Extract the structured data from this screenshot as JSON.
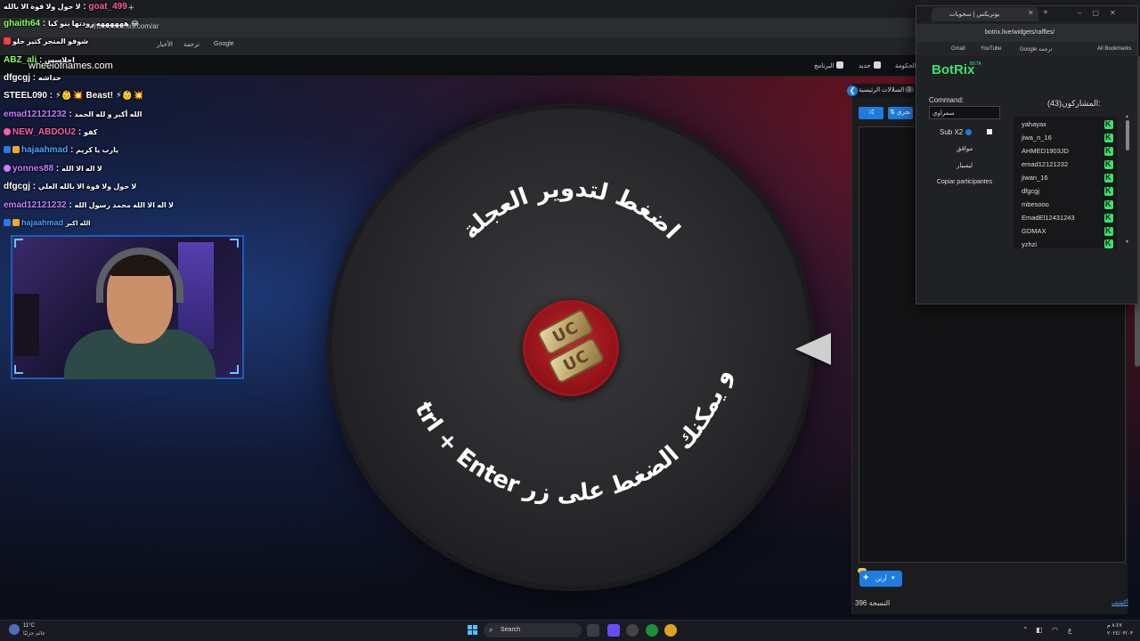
{
  "browser": {
    "new_tab": "+",
    "address_url": "wheelofnames.com/ar",
    "bookmarks": [
      "الأخبار",
      "ترجمة",
      "Google"
    ]
  },
  "site": {
    "logo": "wheelofnames.com",
    "nav": [
      "الحكومة",
      "جديد",
      "البرنامج"
    ]
  },
  "chat": [
    {
      "user": "goat_499",
      "msg": "لا حول ولا قوة الا بالله",
      "color": "#ff5fa0",
      "dir": "rtl-msg-first"
    },
    {
      "user": "ghaith64",
      "msg": "ههههههه زودتها بنو كيا 😂",
      "color": "#8cff5f"
    },
    {
      "user": "",
      "msg": "شوفو المتجر كثير حلو",
      "color": "#ff3b3b"
    },
    {
      "user": "ABZ_ali",
      "msg": "احلاسس",
      "color": "#8cff5f"
    },
    {
      "user": "dfgcgj",
      "msg": "حداشه",
      "color": "#ffffff"
    },
    {
      "user": "STEEL090",
      "msg": "⚡👶💥 Beast! ⚡👶💥",
      "color": "#ffffff"
    },
    {
      "user": "emad12121232",
      "msg": "الله أكبر و لله الحمد",
      "color": "#c77dff"
    },
    {
      "user": "NEW_ABDOU2",
      "msg": "كفو",
      "color": "#ff5fa0"
    },
    {
      "user": "hajaahmad",
      "msg": "يارب يا كريم",
      "color": "#4aa3ff"
    },
    {
      "user": "yonnes88",
      "msg": "لا اله الا الله",
      "color": "#c77dff"
    },
    {
      "user": "dfgcgj",
      "msg": "لا حول ولا قوة الا بالله العلي",
      "color": "#ffffff"
    },
    {
      "user": "emad12121232",
      "msg": "لا اله الا الله محمد رسول الله",
      "color": "#c77dff"
    },
    {
      "user": "hajaahmad",
      "msg": "الله اكبر",
      "color": "#4aa3ff"
    }
  ],
  "wheel": {
    "text_top": "اضغط لتدوير العجلة",
    "text_bottom_1": "أو يمكنك الضغط على زر",
    "text_bottom_2": "Ctrl + Enter",
    "center_label": "UC"
  },
  "entries": {
    "tabs": [
      "السلالات الرئيسية",
      "1"
    ],
    "tool_shuffle": "⤮",
    "tool_sort": "⇅",
    "tool_more": "تجري",
    "add_label": "أرتن",
    "count_text": "النسخة 396",
    "hide_link": "أكشف"
  },
  "popup": {
    "tab_title": "بوتريكس | سحوبات",
    "url": "botrix.live/widgets/raffles/",
    "bookmarks": [
      "Gmail",
      "YouTube",
      "Google ترجمة",
      "All Bookmarks"
    ],
    "logo": "BotRix",
    "beta": "BETA",
    "command_label": "Command:",
    "command_value": "سمراوي",
    "subx2_label": "Sub X2",
    "btn_accept": "موافق",
    "btn_reset": "ليمبيار",
    "btn_copy": "Copiar participantes",
    "participants_title": "(43)المشاركون:",
    "participants": [
      "yahayax",
      "jiwa_n_16",
      "AHMED1903JD",
      "emad12121232",
      "jiwan_16",
      "dfgcgj",
      "mbesooo",
      "EmadEl12431243",
      "GDMAX",
      "yzhzi"
    ]
  },
  "taskbar": {
    "weather_temp": "11°C",
    "weather_text": "غائم جزئيًا",
    "search_label": "Search",
    "time": "٨:٤٧ م",
    "date": "٢٠٢٤/٠٣/٠٣",
    "lang": "ع"
  }
}
